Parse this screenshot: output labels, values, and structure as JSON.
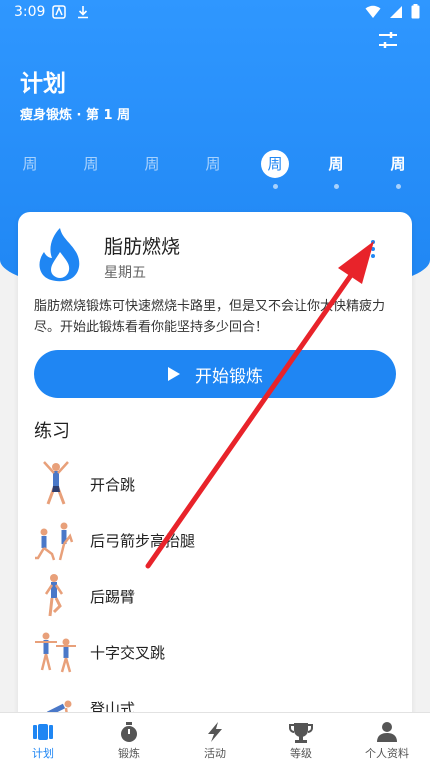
{
  "status": {
    "time": "3:09"
  },
  "header": {
    "title": "计划",
    "subtitle": "瘦身锻炼 · 第 1 周"
  },
  "week": {
    "days": [
      {
        "label": "周",
        "state": "past"
      },
      {
        "label": "周",
        "state": "past"
      },
      {
        "label": "周",
        "state": "past"
      },
      {
        "label": "周",
        "state": "past"
      },
      {
        "label": "周",
        "state": "today"
      },
      {
        "label": "周",
        "state": "upcoming"
      },
      {
        "label": "周",
        "state": "upcoming"
      }
    ]
  },
  "workout": {
    "title": "脂肪燃烧",
    "day": "星期五",
    "description": "脂肪燃烧锻炼可快速燃烧卡路里，但是又不会让你太快精疲力尽。开始此锻炼看看你能坚持多少回合！",
    "start_label": "开始锻炼",
    "icon": "flame-drop-icon",
    "accent_color": "#1f86f3"
  },
  "exercises": {
    "title": "练习",
    "items": [
      {
        "name": "开合跳"
      },
      {
        "name": "后弓箭步高抬腿"
      },
      {
        "name": "后踢臂"
      },
      {
        "name": "十字交叉跳"
      },
      {
        "name": "登山式"
      }
    ]
  },
  "tabs": [
    {
      "label": "计划",
      "icon": "calendar-icon",
      "active": true
    },
    {
      "label": "锻炼",
      "icon": "stopwatch-icon",
      "active": false
    },
    {
      "label": "活动",
      "icon": "lightning-icon",
      "active": false
    },
    {
      "label": "等级",
      "icon": "trophy-icon",
      "active": false
    },
    {
      "label": "个人资料",
      "icon": "person-icon",
      "active": false
    }
  ],
  "annotation": {
    "color": "#e8232a"
  }
}
